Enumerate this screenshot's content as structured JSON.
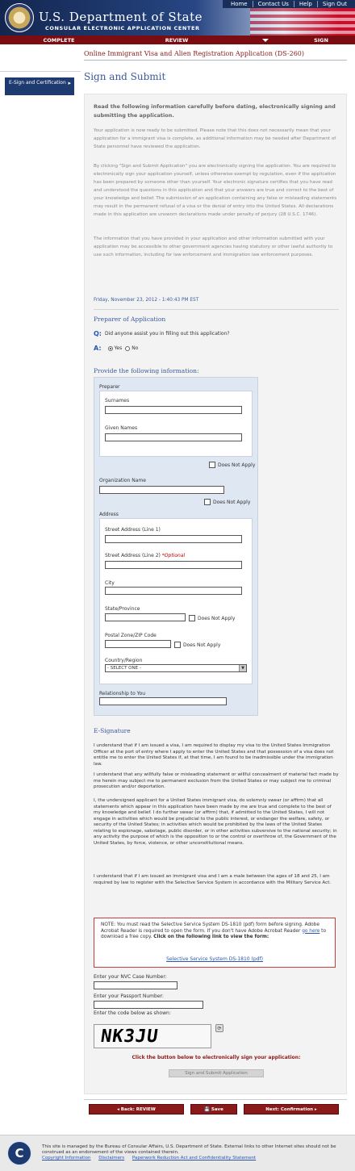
{
  "topnav": [
    "Home",
    "Contact Us",
    "Help",
    "Sign Out"
  ],
  "header": {
    "title": "U.S. Department of State",
    "subtitle": "CONSULAR ELECTRONIC APPLICATION CENTER"
  },
  "progress": [
    "COMPLETE",
    "REVIEW",
    "SIGN"
  ],
  "sidebar": {
    "item": "E-Sign and Certification"
  },
  "main": {
    "app_title": "Online Immigrant Visa and Alien Registration Application (DS-260)",
    "page_title": "Sign and Submit",
    "intro_bold": "Read the following information carefully before dating, electronically signing and submitting the application.",
    "para1": "Your application is now ready to be submitted. Please note that this does not necessarily mean that your application for a immigrant visa is complete, as additional information may be needed after Department of State personnel have reviewed the application.",
    "para2": "By clicking \"Sign and Submit Application\" you are electronically signing the application. You are required to electronically sign your application yourself, unless otherwise exempt by regulation, even if the application has been prepared by someone other than yourself. Your electronic signature certifies that you have read and understood the questions in this application and that your answers are true and correct to the best of your knowledge and belief. The submission of an application containing any false or misleading statements may result in the permanent refusal of a visa or the denial of entry into the United States. All declarations made in this application are unsworn declarations made under penalty of perjury (28 U.S.C. 1746).",
    "para3": "The information that you have provided in your application and other information submitted with your application may be accessible to other government agencies having statutory or other lawful authority to use such information, including for law enforcement and immigration law enforcement purposes.",
    "timestamp": "Friday, November 23, 2012 - 1:40:43 PM EST",
    "preparer_heading": "Preparer of Application",
    "q_label": "Q:",
    "question": "Did anyone assist you in filling out this application?",
    "a_label": "A:",
    "yes": "Yes",
    "no": "No",
    "provide_heading": "Provide the following information:"
  },
  "preparer": {
    "section": "Preparer",
    "surnames": "Surnames",
    "given_names": "Given Names",
    "does_not_apply": "Does Not Apply",
    "org_name": "Organization Name",
    "address": "Address",
    "street1": "Street Address (Line 1)",
    "street2": "Street Address (Line 2)",
    "optional": "*Optional",
    "city": "City",
    "state": "State/Province",
    "postal": "Postal Zone/ZIP Code",
    "country": "Country/Region",
    "country_value": "- SELECT ONE -",
    "relationship": "Relationship to You"
  },
  "esig": {
    "heading": "E-Signature",
    "p1": "I understand that if I am issued a visa, I am required to display my visa to the United States Immigration Officer at the port of entry where I apply to enter the United States and that possession of a visa does not entitle me to enter the United States if, at that time, I am found to be inadmissible under the immigration law.",
    "p2": "I understand that any willfully false or misleading statement or willful concealment of material fact made by me herein may subject me to permanent exclusion from the United States or may subject me to criminal prosecution and/or deportation.",
    "p3": "I, the undersigned applicant for a United States immigrant visa, do solemnly swear (or affirm) that all statements which appear in this application have been made by me are true and complete to the best of my knowledge and belief. I do further swear (or affirm) that, if admitted to the United States, I will not engage in activities which would be prejudicial to the public interest, or endanger the welfare, safety, or security of the United States; in activities which would be prohibited by the laws of the United States relating to espionage, sabotage, public disorder, or in other activities subversive to the national security; in any activity the purpose of which is the opposition to or the control or overthrow of, the Government of the United States, by force, violence, or other unconstitutional means.",
    "p4": "I understand that if I am issued an immigrant visa and I am a male between the ages of 18 and 25, I am required by law to register with the Selective Service System in accordance with the Military Service Act.",
    "note_a": "NOTE: You must read the Selective Service System DS-1810 (pdf) form before signing. Adobe Acrobat Reader is required to open the form. If you don't have Adobe Acrobat Reader ",
    "note_link": "go here",
    "note_b": " to download a free copy. ",
    "note_bold": "Click on the following link to view the form:",
    "form_link": "Selective Service System DS-1810 (pdf)",
    "nvc_label": "Enter your NVC Case Number:",
    "passport_label": "Enter your Passport Number:",
    "code_label": "Enter the code below as shown:",
    "captcha": "NK3JU",
    "click_label": "Click the button below to electronically sign your application:",
    "sign_btn": "Sign and Submit Application"
  },
  "bottom": {
    "back": "◂ Back: REVIEW",
    "save": "💾 Save",
    "next": "Next: Confirmation ▸"
  },
  "footer": {
    "text": "This site is managed by the Bureau of Consular Affairs, U.S. Department of State. External links to other Internet sites should not be construed as an endorsement of the views contained therein.",
    "links": [
      "Copyright Information",
      "Disclaimers",
      "Paperwork Reduction Act and Confidentiality Statement"
    ]
  }
}
